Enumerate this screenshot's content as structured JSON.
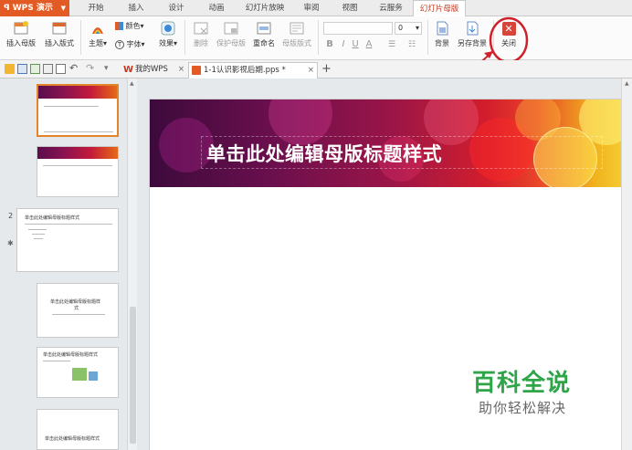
{
  "app": {
    "name": "WPS 演示"
  },
  "menu": {
    "tabs": [
      {
        "label": "开始"
      },
      {
        "label": "插入"
      },
      {
        "label": "设计"
      },
      {
        "label": "动画"
      },
      {
        "label": "幻灯片放映"
      },
      {
        "label": "审阅"
      },
      {
        "label": "视图"
      },
      {
        "label": "云服务"
      },
      {
        "label": "幻灯片母版"
      }
    ]
  },
  "ribbon": {
    "insert_master": "插入母版",
    "insert_layout": "插入版式",
    "theme": "主题",
    "colors": "颜色",
    "fonts": "字体",
    "effects": "效果",
    "delete": "删除",
    "preserve_master": "保护母版",
    "rename": "重命名",
    "master_layout": "母版版式",
    "font_size": "0",
    "bold": "B",
    "italic": "I",
    "underline": "U",
    "font_color": "A",
    "background": "背景",
    "save_background": "另存背景",
    "close": "关闭"
  },
  "tabs": {
    "home_tab": "我的WPS",
    "doc_tab": "1-1认识影视后期.pps *",
    "new_tab": "+"
  },
  "thumbs": {
    "slide_number": "2",
    "title_text": "单击此处编辑母版标题样式",
    "t3_text": "单击此处编辑母版标题样",
    "t3_text2": "式",
    "t4_text": "单击此处编辑母版标题样式",
    "t5_text": "单击此处编辑母版标题样式"
  },
  "slide": {
    "title": "单击此处编辑母版标题样式"
  },
  "watermark": {
    "brand": "百科全说",
    "tagline": "助你轻松解决"
  },
  "colors": {
    "accent": "#e25b24",
    "active_tab": "#c8351c",
    "highlight_ring": "#d0202c",
    "watermark_green": "#2ea548"
  }
}
